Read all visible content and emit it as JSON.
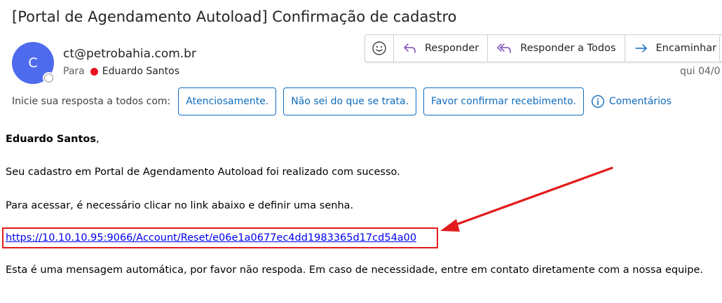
{
  "email": {
    "subject": "[Portal de Agendamento Autoload] Confirmação de cadastro",
    "avatar_initial": "C",
    "sender": "ct@petrobahia.com.br",
    "to_label": "Para",
    "recipient": "Eduardo Santos",
    "date": "qui 04/0"
  },
  "toolbar": {
    "reply": "Responder",
    "reply_all": "Responder a Todos",
    "forward": "Encaminhar"
  },
  "quick_reply": {
    "label": "Inicie sua resposta a todos com:",
    "suggestions": [
      "Atenciosamente.",
      "Não sei do que se trata.",
      "Favor confirmar recebimento."
    ],
    "comments": "Comentários"
  },
  "body": {
    "greeting_name": "Eduardo Santos",
    "greeting_comma": ",",
    "line1": "Seu cadastro em Portal de Agendamento Autoload foi realizado com sucesso.",
    "line2": "Para acessar, é necessário clicar no link abaixo e definir uma senha.",
    "link": "https://10.10.10.95:9066/Account/Reset/e06e1a0677ec4dd1983365d17cd54a00",
    "line3": "Esta é uma mensagem automática, por favor não respoda. Em caso de necessidade, entre em contato diretamente com a nossa equipe."
  },
  "colors": {
    "avatar": "#4f6bed",
    "accent": "#0f6cbd",
    "annotation": "#e21b1b",
    "link": "#0000ee"
  }
}
